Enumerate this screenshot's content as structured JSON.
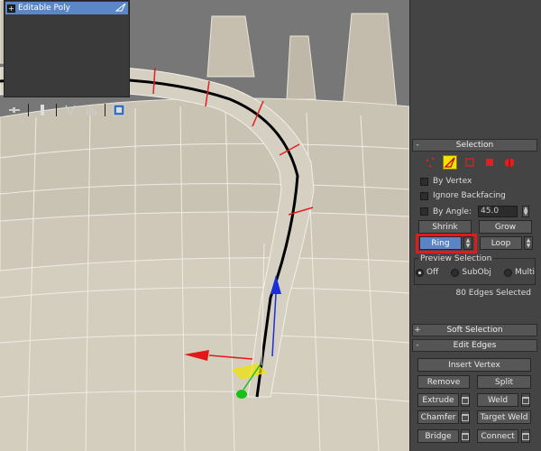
{
  "modifier_stack": {
    "item": "Editable Poly",
    "expand": "+",
    "icon": "triangle-icon"
  },
  "toolbar": {
    "icons": [
      "pin-stack-icon",
      "show-end-result-icon",
      "make-unique-icon",
      "remove-modifier-icon",
      "configure-modifier-sets-icon"
    ]
  },
  "selection": {
    "rollout_sign": "-",
    "title": "Selection",
    "modes": [
      "vertex",
      "edge",
      "border",
      "polygon",
      "element"
    ],
    "active_mode": "edge",
    "by_vertex": "By Vertex",
    "ignore_backfacing": "Ignore Backfacing",
    "by_angle": "By Angle:",
    "angle_value": "45.0",
    "shrink": "Shrink",
    "grow": "Grow",
    "ring": "Ring",
    "loop": "Loop",
    "preview_title": "Preview Selection",
    "preview_off": "Off",
    "preview_subobj": "SubObj",
    "preview_multi": "Multi",
    "status": "80 Edges Selected"
  },
  "soft_selection": {
    "sign": "+",
    "title": "Soft Selection"
  },
  "edit_edges": {
    "sign": "-",
    "title": "Edit Edges",
    "insert_vertex": "Insert Vertex",
    "remove": "Remove",
    "split": "Split",
    "extrude": "Extrude",
    "weld": "Weld",
    "chamfer": "Chamfer",
    "target_weld": "Target Weld",
    "bridge": "Bridge",
    "connect": "Connect"
  },
  "colors": {
    "accent": "#5a84c6",
    "highlight": "#e21a1a",
    "active_mode": "#f0e400",
    "mesh": "#cdc6b5"
  }
}
